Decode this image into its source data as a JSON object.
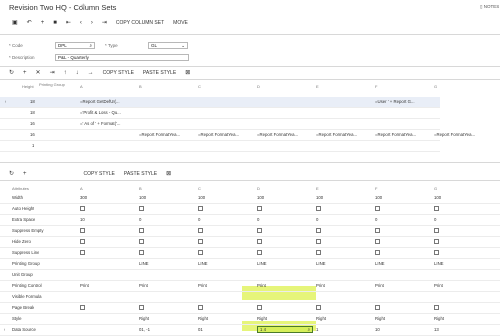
{
  "title": "Revision Two HQ - Column Sets",
  "notes": "NOTES",
  "toolbar": {
    "copy_column_set": "COPY COLUMN SET",
    "move": "MOVE"
  },
  "form": {
    "code_label": "* Code",
    "code_value": "DPL",
    "type_label": "* Type",
    "type_value": "GL",
    "desc_label": "* Description",
    "desc_value": "P&L - Quarterly"
  },
  "grid_toolbar": {
    "copy_style": "COPY STYLE",
    "paste_style": "PASTE STYLE"
  },
  "top_headers": [
    "Height",
    "Printing Group",
    "A",
    "B",
    "C",
    "D",
    "E",
    "F",
    "G"
  ],
  "top_rows": [
    {
      "height": "18",
      "cells": [
        "=Report GetDefUI(...",
        "",
        "",
        "",
        "",
        "=User ' + Report G...",
        ""
      ]
    },
    {
      "height": "18",
      "cells": [
        "='Profit & Loss - Qu...",
        "",
        "",
        "",
        "",
        "",
        ""
      ]
    },
    {
      "height": "16",
      "cells": [
        "=' As of ' + Format('...",
        "",
        "",
        "",
        "",
        "",
        ""
      ]
    },
    {
      "height": "16",
      "cells": [
        "",
        "=Report FormatYea...",
        "=Report FormatYea...",
        "=Report FormatYea...",
        "=Report FormatYea...",
        "=Report FormatYea...",
        "=Report FormatYea..."
      ]
    },
    {
      "height": "1",
      "cells": [
        "",
        "",
        "",
        "",
        "",
        "",
        ""
      ]
    }
  ],
  "bottom_toolbar": {
    "copy_style": "COPY STYLE",
    "paste_style": "PASTE STYLE"
  },
  "attr_header": "Attributes",
  "col_letters": [
    "A",
    "B",
    "C",
    "D",
    "E",
    "F",
    "G"
  ],
  "attributes": [
    {
      "name": "Width",
      "vals": [
        "300",
        "100",
        "100",
        "100",
        "100",
        "100",
        "100"
      ]
    },
    {
      "name": "Auto Height",
      "checks": [
        false,
        false,
        false,
        false,
        false,
        false,
        false
      ]
    },
    {
      "name": "Extra Space",
      "vals": [
        "10",
        "0",
        "0",
        "0",
        "0",
        "0",
        "0"
      ]
    },
    {
      "name": "Suppress Empty",
      "checks": [
        false,
        false,
        false,
        false,
        false,
        false,
        false
      ]
    },
    {
      "name": "Hide Zero",
      "checks": [
        false,
        false,
        false,
        false,
        false,
        false,
        false
      ]
    },
    {
      "name": "Suppress Line",
      "checks": [
        false,
        false,
        false,
        false,
        false,
        false,
        false
      ]
    },
    {
      "name": "Printing Group",
      "vals": [
        "",
        "LINE",
        "LINE",
        "LINE",
        "LINE",
        "LINE",
        "LINE"
      ]
    },
    {
      "name": "Unit Group",
      "vals": [
        "",
        "",
        "",
        "",
        "",
        "",
        ""
      ]
    },
    {
      "name": "Printing Control",
      "vals": [
        "Print",
        "Print",
        "Print",
        "Print",
        "Print",
        "Print",
        "Print"
      ]
    },
    {
      "name": "Visible Formula",
      "vals": [
        "",
        "",
        "",
        "",
        "",
        "",
        ""
      ]
    },
    {
      "name": "Page Break",
      "checks": [
        false,
        false,
        false,
        false,
        false,
        false,
        false
      ]
    },
    {
      "name": "Style",
      "vals": [
        "",
        "Right",
        "Right",
        "Right",
        "Right",
        "Right",
        "Right"
      ]
    },
    {
      "name": "Data Source",
      "vals": [
        "",
        "01, -1",
        "01",
        "1 4",
        "1",
        "10",
        "13"
      ]
    }
  ]
}
